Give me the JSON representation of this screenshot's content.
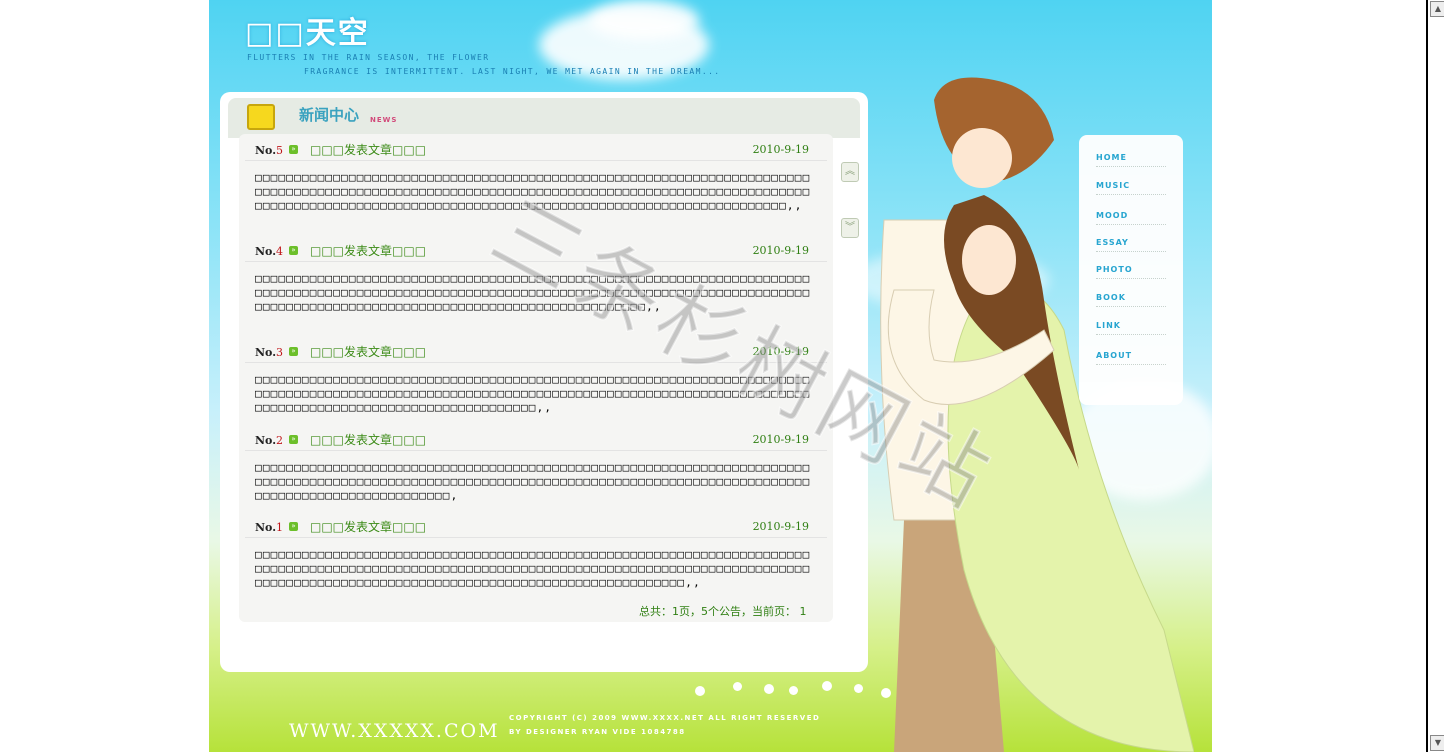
{
  "site": {
    "title": "□□天空",
    "tagline_1": "FLUTTERS IN THE RAIN SEASON, THE FLOWER",
    "tagline_2": "FRAGRANCE IS INTERMITTENT. LAST NIGHT, WE MET AGAIN IN THE DREAM..."
  },
  "section": {
    "title": "新闻中心",
    "subtitle": "NEWS"
  },
  "articles": [
    {
      "no_prefix": "No.",
      "no": "5",
      "title": "□□□发表文章□□□",
      "date": "2010-9-19",
      "body": "□□□□□□□□□□□□□□□□□□□□□□□□□□□□□□□□□□□□□□□□□□□□□□□□□□□□□□□□□□□□□□□□□□□□□□□□□□□□□□□□□□□□□□□□□□□□□□□□□□□□□□□□□□□□□□□□□□□□□□□□□□□□□□□□□□□□□□□□□□□□□□□□□□□□□□□□□□□□□□□□□□□□□□□□□□□□□□□□□□□□□□□□□□□□□□□□□□□□□□□□□□□□□□□□□□,,"
    },
    {
      "no_prefix": "No.",
      "no": "4",
      "title": "□□□发表文章□□□",
      "date": "2010-9-19",
      "body": "□□□□□□□□□□□□□□□□□□□□□□□□□□□□□□□□□□□□□□□□□□□□□□□□□□□□□□□□□□□□□□□□□□□□□□□□□□□□□□□□□□□□□□□□□□□□□□□□□□□□□□□□□□□□□□□□□□□□□□□□□□□□□□□□□□□□□□□□□□□□□□□□□□□□□□□□□□□□□□□□□□□□□□□□□□□□□□□□□□□□□□□□□□□□□□□□,,"
    },
    {
      "no_prefix": "No.",
      "no": "3",
      "title": "□□□发表文章□□□",
      "date": "2010-9-19",
      "body": "□□□□□□□□□□□□□□□□□□□□□□□□□□□□□□□□□□□□□□□□□□□□□□□□□□□□□□□□□□□□□□□□□□□□□□□□□□□□□□□□□□□□□□□□□□□□□□□□□□□□□□□□□□□□□□□□□□□□□□□□□□□□□□□□□□□□□□□□□□□□□□□□□□□□□□□□□□□□□□□□□□□□□□□□□□□□□□□□□□,,"
    },
    {
      "no_prefix": "No.",
      "no": "2",
      "title": "□□□发表文章□□□",
      "date": "2010-9-19",
      "body": "□□□□□□□□□□□□□□□□□□□□□□□□□□□□□□□□□□□□□□□□□□□□□□□□□□□□□□□□□□□□□□□□□□□□□□□□□□□□□□□□□□□□□□□□□□□□□□□□□□□□□□□□□□□□□□□□□□□□□□□□□□□□□□□□□□□□□□□□□□□□□□□□□□□□□□□□□□□□□□□□□□□□□□□,"
    },
    {
      "no_prefix": "No.",
      "no": "1",
      "title": "□□□发表文章□□□",
      "date": "2010-9-19",
      "body": "□□□□□□□□□□□□□□□□□□□□□□□□□□□□□□□□□□□□□□□□□□□□□□□□□□□□□□□□□□□□□□□□□□□□□□□□□□□□□□□□□□□□□□□□□□□□□□□□□□□□□□□□□□□□□□□□□□□□□□□□□□□□□□□□□□□□□□□□□□□□□□□□□□□□□□□□□□□□□□□□□□□□□□□□□□□□□□□□□□□□□□□□□□□□□□□□□□□□□,,"
    }
  ],
  "pager": {
    "text": "总共：1页，5个公告，当前页： 1"
  },
  "nav": {
    "items": [
      "HOME",
      "MUSIC",
      "MOOD",
      "ESSAY",
      "PHOTO",
      "BOOK",
      "LINK",
      "ABOUT"
    ]
  },
  "footer": {
    "url": "WWW.XXXXX.COM",
    "copyright": "COPYRIGHT (C) 2009 WWW.XXXX.NET ALL RIGHT RESERVED",
    "designer": "BY DESIGNER RYAN VIDE 1084788"
  },
  "watermark": {
    "text": "三条杉树网站"
  },
  "colors": {
    "sky": "#4fd3f2",
    "grass": "#b6e23a",
    "link": "#3c8b17",
    "nav": "#23a3cf",
    "number_red": "#c0161a"
  }
}
